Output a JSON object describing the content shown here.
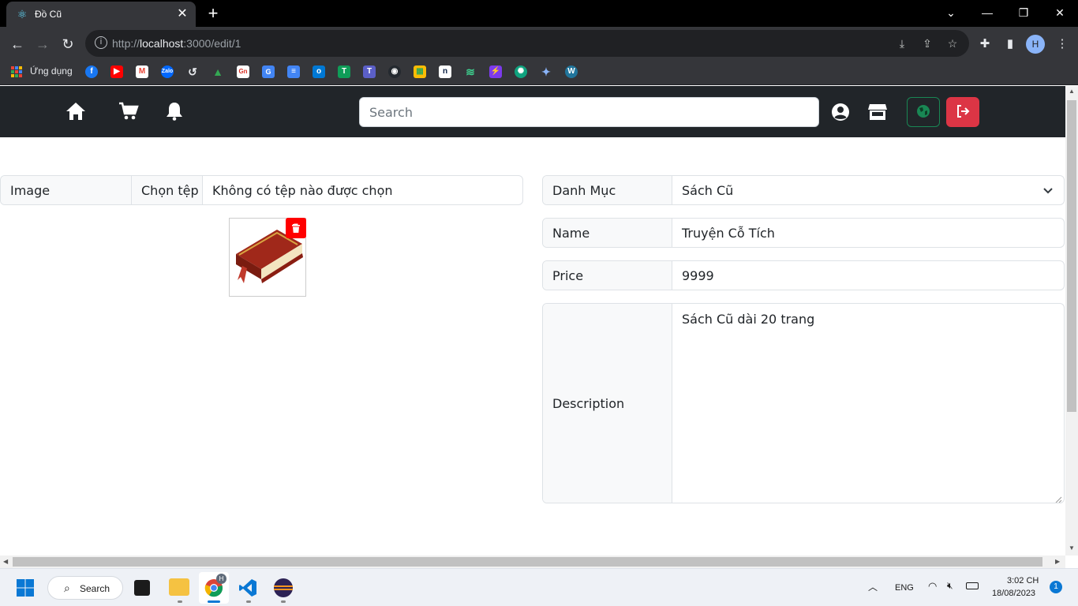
{
  "browser": {
    "tab_title": "Đồ Cũ",
    "tab_icon": "react-icon",
    "url_prefix": "http://",
    "url_host": "localhost",
    "url_rest": ":3000/edit/1",
    "profile_initial": "H",
    "bookmarks_apps_label": "Ứng dụng"
  },
  "navbar": {
    "search_placeholder": "Search",
    "brand_green": "#198754",
    "brand_red": "#dc3545",
    "bg": "#212529"
  },
  "form": {
    "image_label": "Image",
    "file_button": "Chọn tệp",
    "file_status": "Không có tệp nào được chọn",
    "category_label": "Danh Mục",
    "category_value": "Sách Cũ",
    "name_label": "Name",
    "name_value": "Truyện Cỗ Tích",
    "price_label": "Price",
    "price_value": "9999",
    "description_label": "Description",
    "description_value": "Sách Cũ dài 20 trang"
  },
  "taskbar": {
    "search_label": "Search",
    "language": "ENG",
    "time": "3:02 CH",
    "date": "18/08/2023",
    "notification_count": "1"
  }
}
